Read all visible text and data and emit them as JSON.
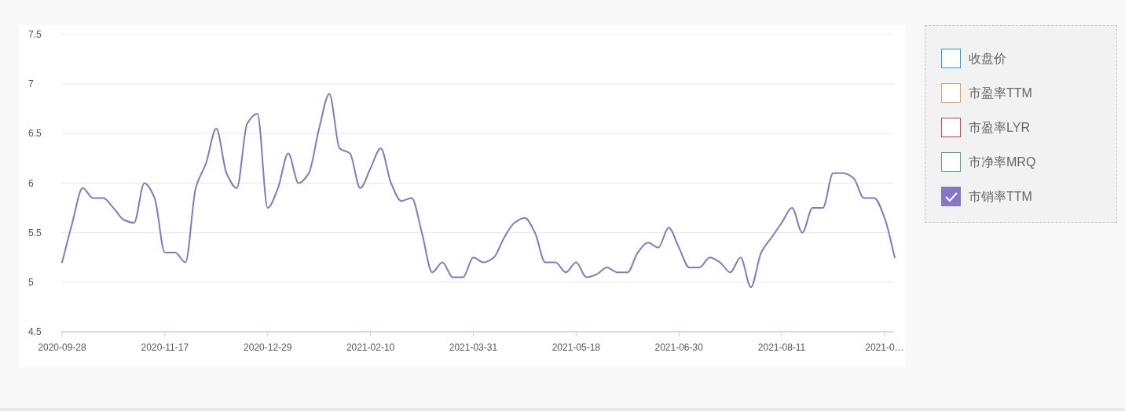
{
  "chart": {
    "chart_data": {
      "type": "line",
      "categories": [
        "2020-09-28",
        null,
        null,
        null,
        null,
        null,
        null,
        null,
        null,
        null,
        "2020-11-17",
        null,
        null,
        null,
        null,
        null,
        null,
        null,
        null,
        null,
        "2020-12-29",
        null,
        null,
        null,
        null,
        null,
        null,
        null,
        null,
        null,
        "2021-02-10",
        null,
        null,
        null,
        null,
        null,
        null,
        null,
        null,
        null,
        "2021-03-31",
        null,
        null,
        null,
        null,
        null,
        null,
        null,
        null,
        null,
        "2021-05-18",
        null,
        null,
        null,
        null,
        null,
        null,
        null,
        null,
        null,
        "2021-06-30",
        null,
        null,
        null,
        null,
        null,
        null,
        null,
        null,
        null,
        "2021-08-11",
        null,
        null,
        null,
        null,
        null,
        null,
        null,
        null,
        null,
        "2021-0…",
        null
      ],
      "series": [
        {
          "color": "#8677c4",
          "values": [
            5.2,
            5.6,
            5.95,
            5.85,
            5.85,
            5.75,
            5.63,
            5.6,
            6.0,
            5.85,
            5.3,
            5.3,
            5.2,
            5.95,
            6.2,
            6.55,
            6.1,
            5.95,
            6.6,
            6.7,
            5.75,
            5.95,
            6.3,
            6.0,
            6.1,
            6.55,
            6.9,
            6.35,
            6.3,
            5.95,
            6.15,
            6.35,
            6.0,
            5.82,
            5.85,
            5.5,
            5.1,
            5.2,
            5.05,
            5.05,
            5.25,
            5.2,
            5.25,
            5.45,
            5.6,
            5.65,
            5.5,
            5.2,
            5.2,
            5.1,
            5.2,
            5.05,
            5.08,
            5.15,
            5.1,
            5.1,
            5.3,
            5.4,
            5.35,
            5.55,
            5.35,
            5.15,
            5.15,
            5.25,
            5.2,
            5.1,
            5.25,
            4.95,
            5.3,
            5.45,
            5.6,
            5.75,
            5.5,
            5.75,
            5.75,
            6.1,
            6.1,
            6.05,
            5.85,
            5.85,
            5.65,
            5.25
          ]
        }
      ],
      "ylim": [
        4.5,
        7.5
      ],
      "grid": true,
      "yticks": [
        4.5,
        5,
        5.5,
        6,
        6.5,
        7,
        7.5
      ]
    }
  },
  "legend": [
    {
      "label": "收盘价",
      "checked": false,
      "color": "#1fa0e0"
    },
    {
      "label": "市盈率TTM",
      "checked": false,
      "color": "#f0a050"
    },
    {
      "label": "市盈率LYR",
      "checked": false,
      "color": "#e84040"
    },
    {
      "label": "市净率MRQ",
      "checked": false,
      "color": "#50a880"
    },
    {
      "label": "市销率TTM",
      "checked": true,
      "color": "#8677c4"
    }
  ]
}
